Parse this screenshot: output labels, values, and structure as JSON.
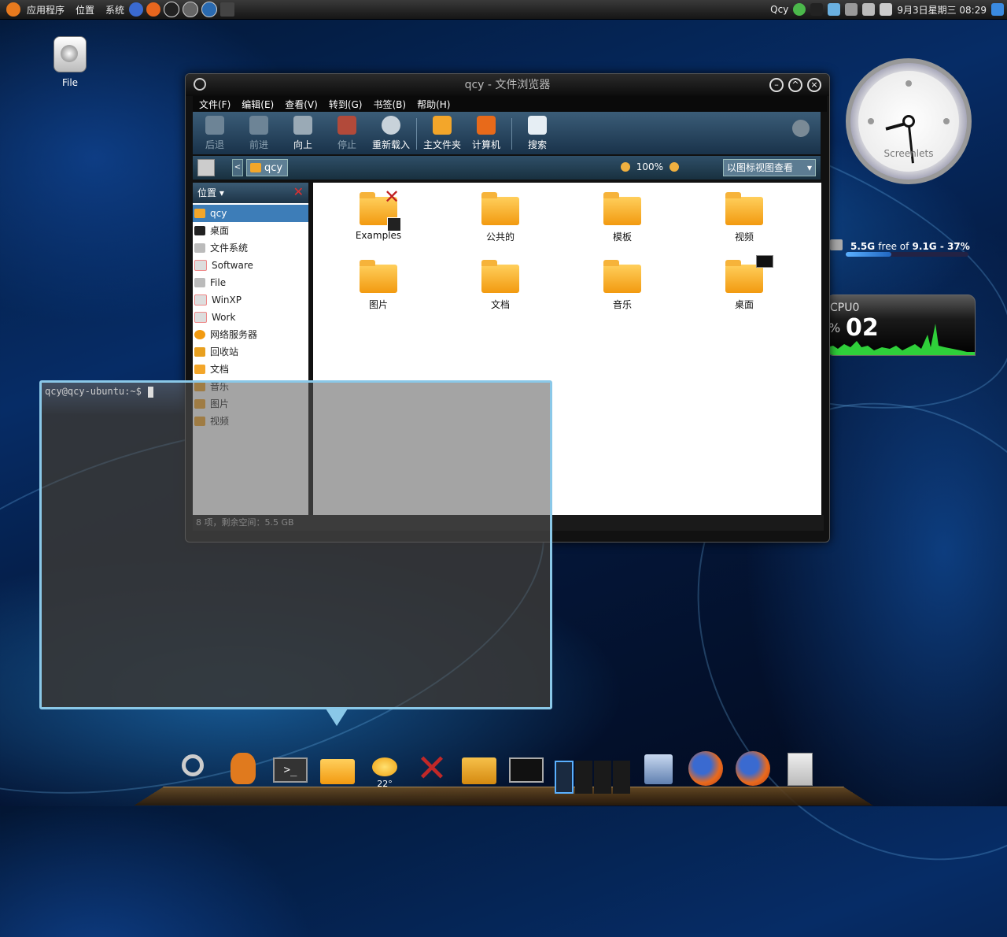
{
  "top_panel": {
    "menus": [
      "应用程序",
      "位置",
      "系统"
    ],
    "user": "Qcy",
    "datetime": "9月3日星期三 08:29"
  },
  "desktop": {
    "file_icon_label": "File"
  },
  "file_browser": {
    "title": "qcy - 文件浏览器",
    "menu": [
      "文件(F)",
      "编辑(E)",
      "查看(V)",
      "转到(G)",
      "书签(B)",
      "帮助(H)"
    ],
    "toolbar": {
      "back": "后退",
      "forward": "前进",
      "up": "向上",
      "stop": "停止",
      "reload": "重新载入",
      "home": "主文件夹",
      "computer": "计算机",
      "search": "搜索"
    },
    "location": {
      "crumb": "qcy",
      "zoom": "100%",
      "view_mode": "以图标视图查看"
    },
    "side_pane": {
      "header": "位置",
      "items": [
        "qcy",
        "桌面",
        "文件系统",
        "Software",
        "File",
        "WinXP",
        "Work",
        "网络服务器",
        "回收站",
        "文档",
        "音乐",
        "图片",
        "视频"
      ]
    },
    "files": [
      "Examples",
      "公共的",
      "模板",
      "视频",
      "图片",
      "文档",
      "音乐",
      "桌面"
    ],
    "status": "8 项，剩余空间：5.5 GB"
  },
  "terminal": {
    "prompt": "qcy@qcy-ubuntu:~$"
  },
  "clock": {
    "label": "Screenlets"
  },
  "disk_widget": {
    "free": "5.5G",
    "free_word": "free of",
    "total": "9.1G",
    "percent_text": "37%",
    "used_fraction": 0.37
  },
  "cpu_widget": {
    "title": "CPU0",
    "value": "02",
    "unit": "%"
  },
  "dock": {
    "weather_temp": "22°"
  }
}
